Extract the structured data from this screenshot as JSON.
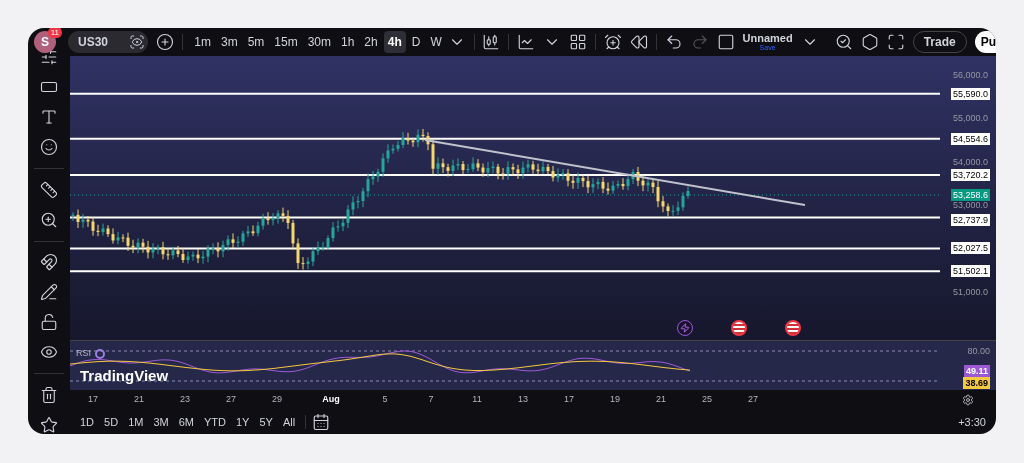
{
  "header": {
    "avatar": "S",
    "notifications": "11",
    "symbol": "US30",
    "intervals": [
      {
        "label": "1m",
        "selected": false
      },
      {
        "label": "3m",
        "selected": false
      },
      {
        "label": "5m",
        "selected": false
      },
      {
        "label": "15m",
        "selected": false
      },
      {
        "label": "30m",
        "selected": false
      },
      {
        "label": "1h",
        "selected": false
      },
      {
        "label": "2h",
        "selected": false
      },
      {
        "label": "4h",
        "selected": true
      },
      {
        "label": "D",
        "selected": false
      },
      {
        "label": "W",
        "selected": false
      }
    ],
    "layout_name": "Unnamed",
    "save_label": "Save",
    "trade_button": "Trade",
    "publish_button": "Pu"
  },
  "price_axis": {
    "ticks": [
      "56,000.0",
      "55,000.0",
      "54,000.0",
      "53,000.0",
      "51,000.0"
    ],
    "levels": [
      {
        "label": "55,590.0"
      },
      {
        "label": "54,554.6"
      },
      {
        "label": "53,720.2"
      },
      {
        "label": "52,737.9"
      },
      {
        "label": "52,027.5"
      },
      {
        "label": "51,502.1"
      }
    ],
    "current_price": "53,258.6"
  },
  "rsi": {
    "label": "RSI",
    "axis_tick": "80.00",
    "readings": [
      {
        "value": "49.11",
        "color": "#9b59d6"
      },
      {
        "value": "38.69",
        "color": "#f5c842"
      }
    ]
  },
  "logo": "TradingView",
  "time_axis": [
    {
      "label": "17",
      "kind": "day"
    },
    {
      "label": "21",
      "kind": "day"
    },
    {
      "label": "23",
      "kind": "day"
    },
    {
      "label": "27",
      "kind": "day"
    },
    {
      "label": "29",
      "kind": "day"
    },
    {
      "label": "Aug",
      "kind": "month"
    },
    {
      "label": "5",
      "kind": "day"
    },
    {
      "label": "7",
      "kind": "day"
    },
    {
      "label": "11",
      "kind": "day"
    },
    {
      "label": "13",
      "kind": "day"
    },
    {
      "label": "17",
      "kind": "day"
    },
    {
      "label": "19",
      "kind": "day"
    },
    {
      "label": "21",
      "kind": "day"
    },
    {
      "label": "25",
      "kind": "day"
    },
    {
      "label": "27",
      "kind": "day"
    }
  ],
  "ranges": [
    "1D",
    "5D",
    "1M",
    "3M",
    "6M",
    "YTD",
    "1Y",
    "5Y",
    "All"
  ],
  "timezone": "+3:30"
}
